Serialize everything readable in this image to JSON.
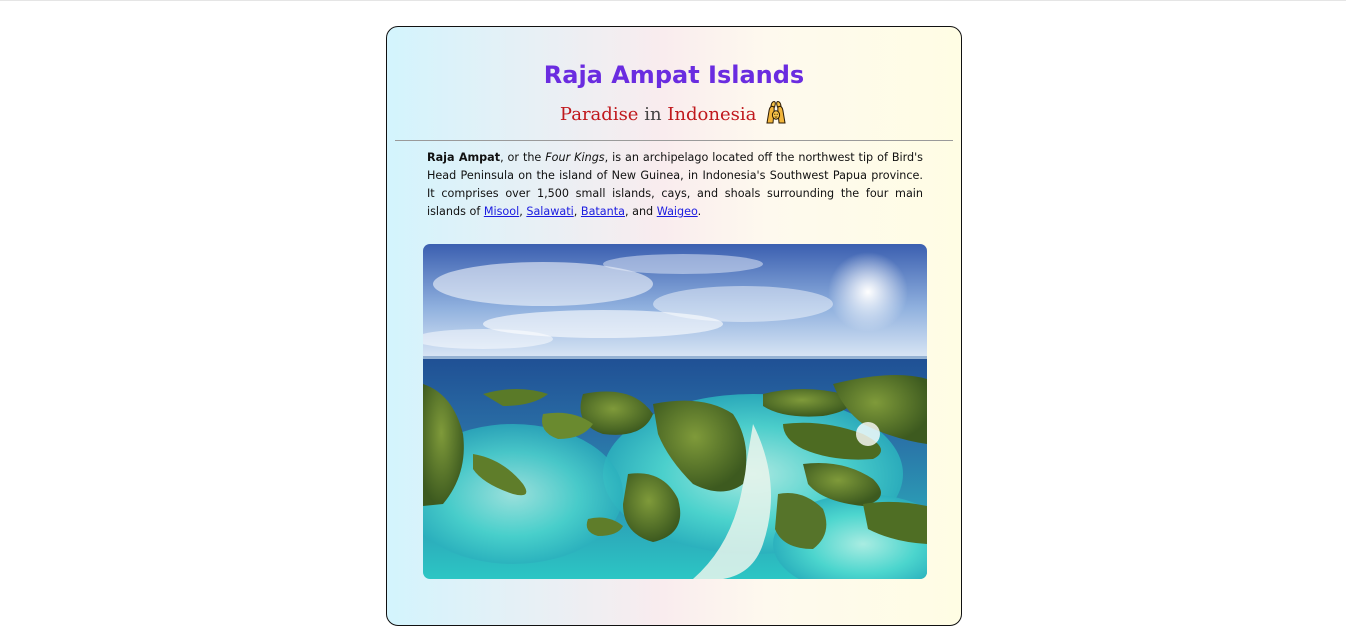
{
  "page": {
    "title": "Raja Ampat Islands",
    "subtitle": {
      "word1": "Paradise",
      "word2": "in",
      "word3": "Indonesia"
    },
    "subtitle_icon": "raising-hands-icon",
    "description": {
      "bold_name": "Raja Ampat",
      "text1": ", or the ",
      "italic_name": "Four Kings",
      "text2": ", is an archipelago located off the northwest tip of Bird's Head Peninsula on the island of New Guinea, in Indonesia's Southwest Papua province. It comprises over 1,500 small islands, cays, and shoals surrounding the four main islands of ",
      "link1": "Misool",
      "sep1": ", ",
      "link2": "Salawati",
      "sep2": ", ",
      "link3": "Batanta",
      "sep3": ", and ",
      "link4": "Waigeo",
      "end": "."
    },
    "image": {
      "alt": "Aerial view of Raja Ampat islands"
    }
  },
  "colors": {
    "title": "#6a2ce0",
    "subtitle_accent": "#c0181c",
    "link": "#1a1ae0",
    "card_gradient": [
      "#d3f4fd",
      "#f9ecee",
      "#fffde4"
    ]
  }
}
